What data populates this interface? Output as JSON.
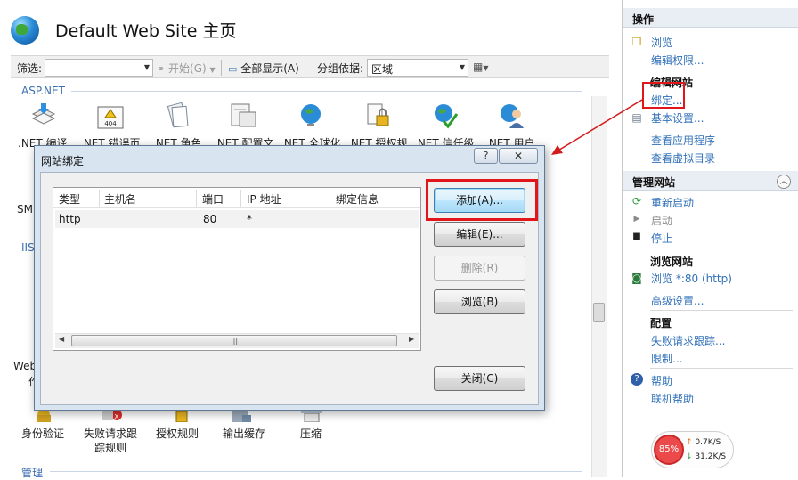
{
  "main": {
    "title": "Default Web Site 主页",
    "toolbar": {
      "filter_label": "筛选:",
      "filter_value": "",
      "go_label": "开始(G)",
      "show_all_label": "全部显示(A)",
      "group_by_label": "分组依据:",
      "group_by_value": "区域"
    },
    "sections": {
      "aspnet": "ASP.NET",
      "iis_partial": "IIS",
      "manage": "管理"
    },
    "aspnet_features": [
      ".NET 编译",
      ".NET 错误页",
      ".NET 角色",
      ".NET 配置文",
      ".NET 全球化",
      ".NET 授权规",
      ".NET 信任级",
      ".NET 用户"
    ],
    "partial_labels": {
      "sm": "SM",
      "web": "Web",
      "zuo": "作"
    },
    "iis_features": [
      "身份验证",
      "失败请求跟",
      "授权规则",
      "输出缓存",
      "压缩"
    ],
    "iis_feature_second_line": "踪规则"
  },
  "actions": {
    "header": "操作",
    "browse": "浏览",
    "edit_permissions": "编辑权限...",
    "edit_site_group": "编辑网站",
    "bindings": "绑定...",
    "basic_settings": "基本设置...",
    "view_apps": "查看应用程序",
    "view_vdirs": "查看虚拟目录",
    "manage_site_header": "管理网站",
    "restart": "重新启动",
    "start": "启动",
    "stop": "停止",
    "browse_site_group": "浏览网站",
    "browse_80": "浏览 *:80 (http)",
    "advanced_settings": "高级设置...",
    "config_group": "配置",
    "failed_request_tracing": "失败请求跟踪...",
    "limits": "限制...",
    "help": "帮助",
    "online_help": "联机帮助"
  },
  "net_meter": {
    "percent": "85%",
    "up": "0.7K/S",
    "down": "31.2K/S"
  },
  "dialog": {
    "title": "网站绑定",
    "help_glyph": "?",
    "close_glyph": "✕",
    "columns": [
      "类型",
      "主机名",
      "端口",
      "IP 地址",
      "绑定信息"
    ],
    "rows": [
      {
        "type": "http",
        "host": "",
        "port": "80",
        "ip": "*",
        "info": ""
      }
    ],
    "buttons": {
      "add": "添加(A)...",
      "edit": "编辑(E)...",
      "remove": "删除(R)",
      "browse": "浏览(B)",
      "close": "关闭(C)"
    }
  },
  "colors": {
    "link": "#3070b8",
    "highlight": "#e0161b",
    "pane_header": "#e9eef5"
  }
}
